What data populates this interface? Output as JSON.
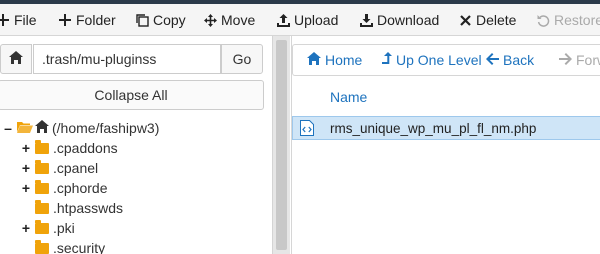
{
  "toolbar": {
    "items": [
      {
        "label": "File",
        "icon": "plus-icon"
      },
      {
        "label": "Folder",
        "icon": "plus-icon"
      },
      {
        "label": "Copy",
        "icon": "copy-icon"
      },
      {
        "label": "Move",
        "icon": "move-icon"
      },
      {
        "label": "Upload",
        "icon": "upload-icon"
      },
      {
        "label": "Download",
        "icon": "download-icon"
      },
      {
        "label": "Delete",
        "icon": "times-icon"
      },
      {
        "label": "Restore",
        "icon": "undo-icon",
        "disabled": true
      }
    ]
  },
  "path": {
    "value": ".trash/mu-pluginss",
    "go_label": "Go"
  },
  "collapse_label": "Collapse All",
  "tree": {
    "root": {
      "label": "(/home/fashipw3)",
      "toggle": "–"
    },
    "children": [
      {
        "label": ".cpaddons",
        "toggle": "+"
      },
      {
        "label": ".cpanel",
        "toggle": "+"
      },
      {
        "label": ".cphorde",
        "toggle": "+"
      },
      {
        "label": ".htpasswds",
        "toggle": ""
      },
      {
        "label": ".pki",
        "toggle": "+"
      },
      {
        "label": ".security",
        "toggle": ""
      }
    ]
  },
  "nav": {
    "home": "Home",
    "up": "Up One Level",
    "back": "Back",
    "forward": "Forw"
  },
  "table": {
    "header_name": "Name",
    "rows": [
      {
        "name": "rms_unique_wp_mu_pl_fl_nm.php",
        "selected": true
      }
    ]
  },
  "colors": {
    "accent": "#1e73be",
    "folder": "#f0a30a",
    "selected_row": "#cfe5f7"
  }
}
